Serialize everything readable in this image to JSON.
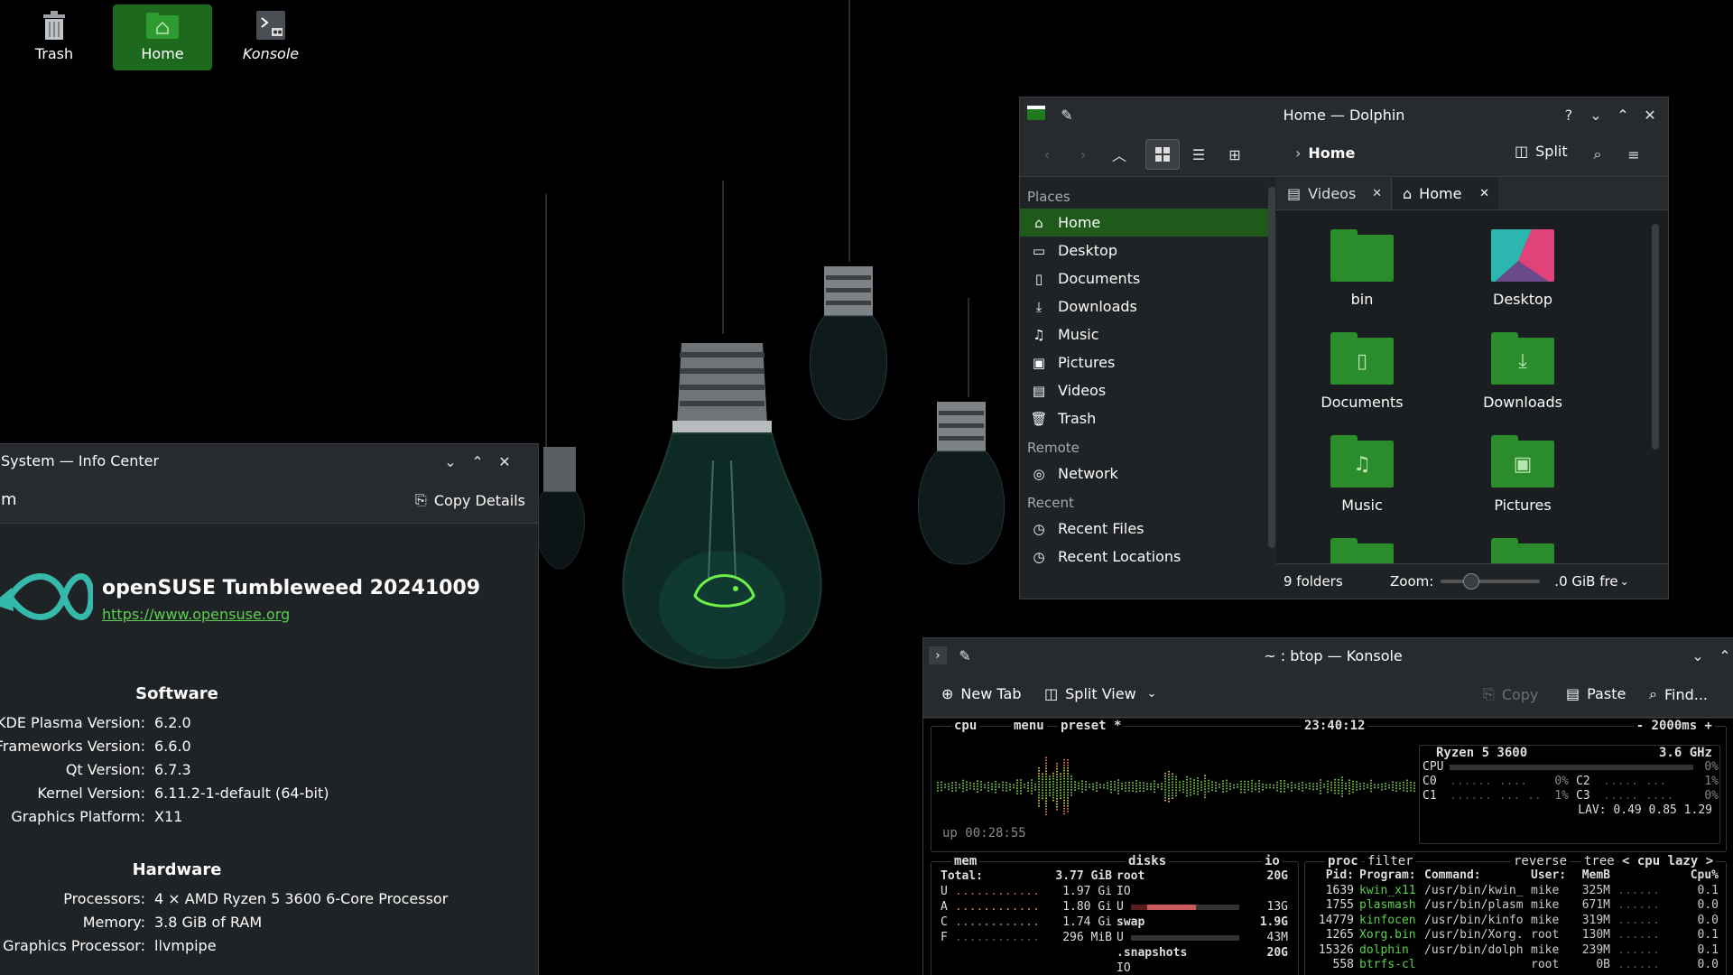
{
  "desktop": {
    "icons": [
      {
        "label": "Trash",
        "icon": "trash-icon"
      },
      {
        "label": "Home",
        "icon": "home-folder-icon"
      },
      {
        "label": "Konsole",
        "icon": "konsole-icon"
      }
    ]
  },
  "dolphin": {
    "title": "Home — Dolphin",
    "breadcrumb": "Home",
    "split_label": "Split",
    "places_header": "Places",
    "places": [
      "Home",
      "Desktop",
      "Documents",
      "Downloads",
      "Music",
      "Pictures",
      "Videos",
      "Trash"
    ],
    "remote_header": "Remote",
    "remote": [
      "Network"
    ],
    "recent_header": "Recent",
    "recent": [
      "Recent Files",
      "Recent Locations"
    ],
    "tabs": [
      "Videos",
      "Home"
    ],
    "folders": [
      "bin",
      "Desktop",
      "Documents",
      "Downloads",
      "Music",
      "Pictures"
    ],
    "status": "9 folders",
    "zoom_label": "Zoom:",
    "free_space": ".0 GiB fre"
  },
  "infocenter": {
    "title": "System — Info Center",
    "page_title_fragment": "m",
    "copy_details": "Copy Details",
    "distro": "openSUSE Tumbleweed 20241009",
    "url": "https://www.opensuse.org",
    "software_header": "Software",
    "software": [
      {
        "k": "KDE Plasma Version:",
        "v": "6.2.0"
      },
      {
        "k": "Frameworks Version:",
        "v": "6.6.0"
      },
      {
        "k": "Qt Version:",
        "v": "6.7.3"
      },
      {
        "k": "Kernel Version:",
        "v": "6.11.2-1-default (64-bit)"
      },
      {
        "k": "Graphics Platform:",
        "v": "X11"
      }
    ],
    "hardware_header": "Hardware",
    "hardware": [
      {
        "k": "Processors:",
        "v": "4 × AMD Ryzen 5 3600 6-Core Processor"
      },
      {
        "k": "Memory:",
        "v": "3.8 GiB of RAM"
      },
      {
        "k": "Graphics Processor:",
        "v": "llvmpipe"
      }
    ]
  },
  "konsole": {
    "title": "~ : btop — Konsole",
    "toolbar": {
      "new_tab": "New Tab",
      "split_view": "Split View",
      "copy": "Copy",
      "paste": "Paste",
      "find": "Find..."
    },
    "btop": {
      "cpu_box": "cpu",
      "menu": "menu",
      "preset": "preset *",
      "clock": "23:40:12",
      "interval": "- 2000ms +",
      "uptime": "up 00:28:55",
      "cpu_model": "Ryzen 5 3600",
      "cpu_freq": "3.6 GHz",
      "cpu_rows": [
        {
          "l": "CPU",
          "v": "0%"
        },
        {
          "l": "C0",
          "v": "0%",
          "l2": "C2",
          "v2": "1%"
        },
        {
          "l": "C1",
          "v": "1%",
          "l2": "C3",
          "v2": "0%"
        }
      ],
      "lav": "LAV: 0.49 0.85 1.29",
      "mem_box": "mem",
      "mem_total_label": "Total:",
      "mem_total": "3.77 GiB",
      "mem_rows": [
        {
          "l": "U",
          "v": "1.97 Gi"
        },
        {
          "l": "A",
          "v": "1.80 Gi"
        },
        {
          "l": "C",
          "v": "1.74 Gi"
        },
        {
          "l": "F",
          "v": "296 MiB"
        }
      ],
      "disks_box": "disks",
      "io_box": "io",
      "disks": [
        {
          "name": "root",
          "size": "20G"
        },
        {
          "name": "IO",
          "size": ""
        },
        {
          "name": "U",
          "size": "13G"
        },
        {
          "name": "swap",
          "size": "1.9G"
        },
        {
          "name": "U",
          "size": "43M"
        },
        {
          "name": ".snapshots",
          "size": "20G"
        },
        {
          "name": "IO",
          "size": ""
        }
      ],
      "proc_box": "proc",
      "filter": "filter",
      "reverse": "reverse",
      "tree": "tree",
      "sort": "< cpu lazy >",
      "proc_headers": [
        "Pid:",
        "Program:",
        "Command:",
        "User:",
        "MemB",
        "Cpu%"
      ],
      "procs": [
        {
          "pid": "1639",
          "prog": "kwin_x11",
          "cmd": "/usr/bin/kwin_",
          "user": "mike",
          "mem": "325M",
          "cpu": "0.1"
        },
        {
          "pid": "1755",
          "prog": "plasmash",
          "cmd": "/usr/bin/plasm",
          "user": "mike",
          "mem": "671M",
          "cpu": "0.0"
        },
        {
          "pid": "14779",
          "prog": "kinfocen",
          "cmd": "/usr/bin/kinfo",
          "user": "mike",
          "mem": "319M",
          "cpu": "0.0"
        },
        {
          "pid": "1265",
          "prog": "Xorg.bin",
          "cmd": "/usr/bin/Xorg.",
          "user": "root",
          "mem": "130M",
          "cpu": "0.1"
        },
        {
          "pid": "15326",
          "prog": "dolphin",
          "cmd": "/usr/bin/dolph",
          "user": "mike",
          "mem": "239M",
          "cpu": "0.1"
        },
        {
          "pid": "558",
          "prog": "btrfs-cl",
          "cmd": "",
          "user": "root",
          "mem": "0B",
          "cpu": "0.0"
        }
      ]
    }
  }
}
